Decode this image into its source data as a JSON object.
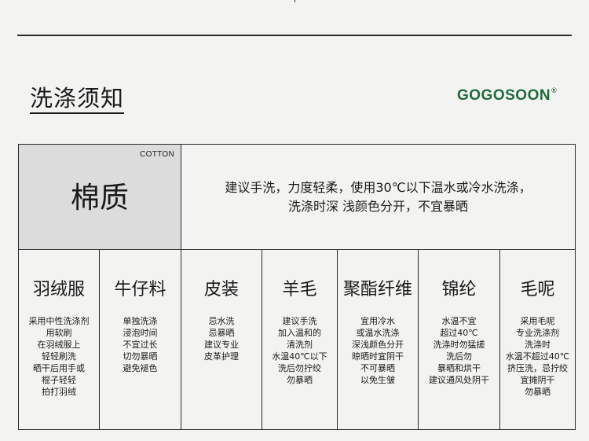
{
  "header": {
    "title": "洗涤须知",
    "brand": "GOGOSOON",
    "brand_mark": "®",
    "brand_color": "#1f6a3c"
  },
  "cotton": {
    "label_en": "COTTON",
    "label_zh": "棉质",
    "desc_lines": [
      "建议手洗，力度轻柔，使用30℃以下温水或冷水洗涤，",
      "洗涤时深 浅颜色分开，不宜暴晒"
    ]
  },
  "fabrics": [
    {
      "name": "羽绒服",
      "lines": [
        "采用中性洗涤剂",
        "用软刷",
        "在羽绒服上",
        "轻轻刷洗",
        "晒干后用手或",
        "棍子轻轻",
        "拍打羽绒"
      ]
    },
    {
      "name": "牛仔料",
      "lines": [
        "单独洗涤",
        "浸泡时间",
        "不宜过长",
        "切勿暴晒",
        "避免褪色"
      ]
    },
    {
      "name": "皮装",
      "lines": [
        "忌水洗",
        "忌暴晒",
        "建议专业",
        "皮革护理"
      ]
    },
    {
      "name": "羊毛",
      "lines": [
        "建议手洗",
        "加入温和的",
        "清洗剂",
        "水温40℃以下",
        "洗后勿拧绞",
        "勿暴晒"
      ]
    },
    {
      "name": "聚酯纤维",
      "lines": [
        "宜用冷水",
        "或温水洗涤",
        "深浅颜色分开",
        "晾晒时宜阴干",
        "不可暴晒",
        "以免生皱"
      ]
    },
    {
      "name": "锦纶",
      "lines": [
        "水温不宜",
        "超过40℃",
        "洗涤时勿猛搓",
        "洗后勿",
        "暴晒和烘干",
        "建议通风处阴干"
      ]
    },
    {
      "name": "毛呢",
      "lines": [
        "采用毛呢",
        "专业洗涤剂",
        "洗涤时",
        "水温不超过40℃",
        "挤压洗，忌拧绞",
        "宜摊阴干",
        "勿暴晒"
      ]
    }
  ]
}
